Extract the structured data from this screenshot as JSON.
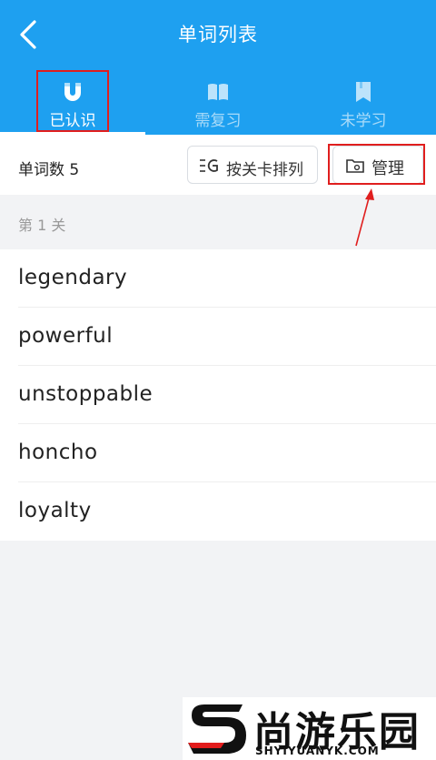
{
  "header": {
    "title": "单词列表"
  },
  "tabs": [
    {
      "label": "已认识",
      "icon": "magnet-icon",
      "active": true
    },
    {
      "label": "需复习",
      "icon": "book-icon",
      "active": false
    },
    {
      "label": "未学习",
      "icon": "bookmark-icon",
      "active": false
    }
  ],
  "toolbar": {
    "count_label": "单词数 5",
    "sort_label": "按关卡排列",
    "manage_label": "管理"
  },
  "section": {
    "title": "第 1 关"
  },
  "words": [
    "legendary",
    "powerful",
    "unstoppable",
    "honcho",
    "loyalty"
  ],
  "watermark": {
    "brand": "尚游乐园",
    "url": "SHYIYUANYK.COM"
  },
  "colors": {
    "header": "#1ea0f0",
    "highlight": "#e01e1e"
  }
}
